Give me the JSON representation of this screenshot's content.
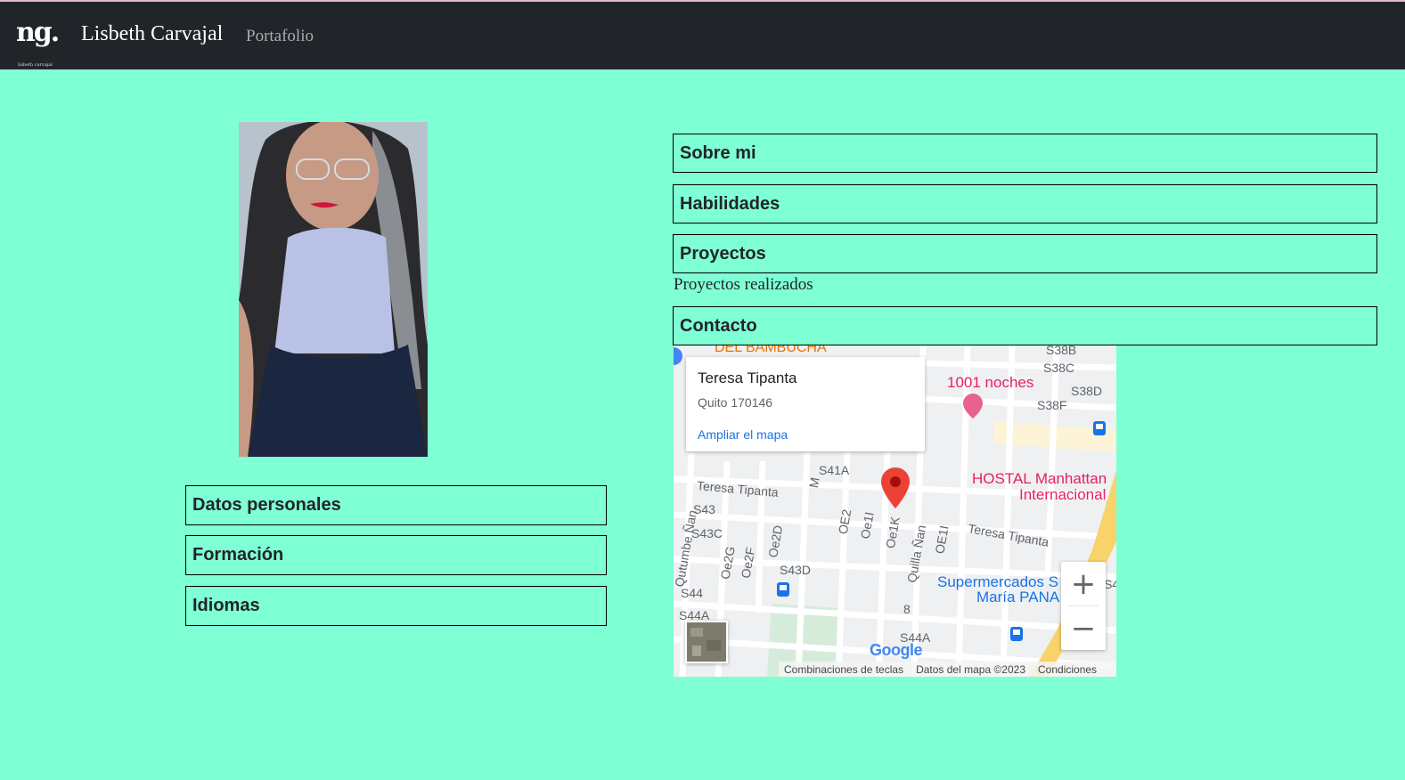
{
  "navbar": {
    "logo_text": "ng.",
    "logo_small": "lisbeth carvajal",
    "brand_name": "Lisbeth Carvajal",
    "link_portafolio": "Portafolio"
  },
  "left": {
    "items": [
      {
        "label": "Datos personales"
      },
      {
        "label": "Formación"
      },
      {
        "label": "Idiomas"
      }
    ]
  },
  "right": {
    "sobre_mi": "Sobre mi",
    "habilidades": "Habilidades",
    "proyectos": "Proyectos",
    "proyectos_text": "Proyectos realizados",
    "contacto": "Contacto"
  },
  "map": {
    "place_title": "Teresa Tipanta",
    "place_sub": "Quito 170146",
    "link_expand": "Ampliar el mapa",
    "zoom_in": "+",
    "zoom_out": "−",
    "footer_shortcuts": "Combinaciones de teclas",
    "footer_data": "Datos del mapa ©2023",
    "footer_terms": "Condiciones",
    "google": "Google",
    "labels": {
      "bambucha": "DEL BAMBUCHA",
      "noches": "1001 noches",
      "hostal1": "HOSTAL Manhattan",
      "hostal2": "Internacional",
      "super1": "Supermercados S",
      "super2": "María PANA",
      "teresa_left": "Teresa Tipanta",
      "teresa_right": "Teresa Tipanta",
      "s38b": "S38B",
      "s38c": "S38C",
      "s38d": "S38D",
      "s38f": "S38F",
      "s41a": "S41A",
      "s43": "S43",
      "s43c": "S43C",
      "s43d": "S43D",
      "s44": "S44",
      "s44a": "S44A",
      "s44a2": "S44A",
      "oe2": "OE2",
      "oe1i": "Oe1I",
      "oe1k": "Oe1K",
      "quilla": "Quilla Ñan",
      "oe1i2": "OE1I",
      "oe2g": "Oe2G",
      "oe2f": "Oe2F",
      "oe2d": "Oe2D",
      "m": "M",
      "qutumbe": "Qutumbe Ñan",
      "eight": "8",
      "s4": "S4"
    }
  },
  "colors": {
    "background": "#7fffd4",
    "navbar": "#212529",
    "marker": "#ea4335",
    "poi_pink": "#e91e63",
    "road_yellow": "#f8d26a"
  }
}
